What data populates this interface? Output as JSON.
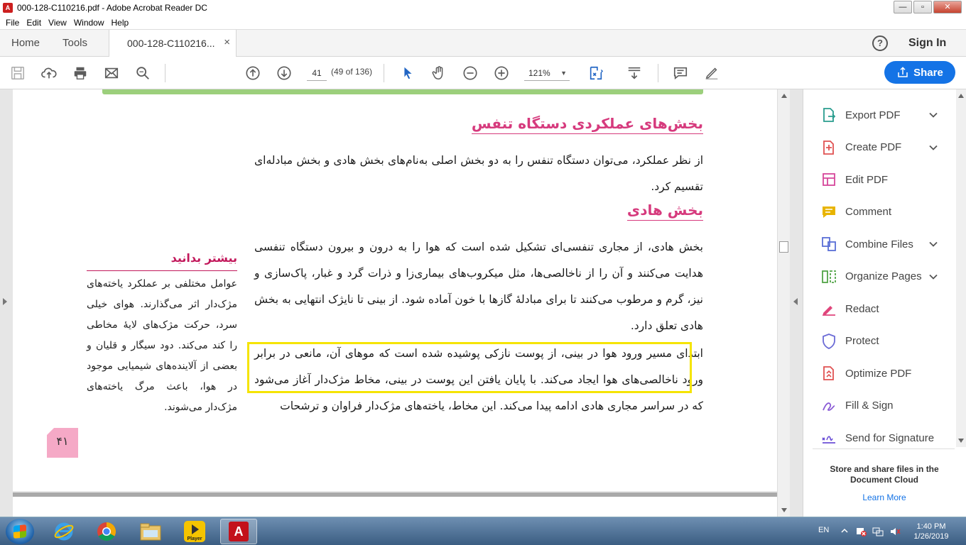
{
  "window": {
    "title": "000-128-C110216.pdf - Adobe Acrobat Reader DC",
    "buttons": {
      "minimize": "—",
      "maximize": "▫",
      "close": "✕"
    }
  },
  "menu": [
    "File",
    "Edit",
    "View",
    "Window",
    "Help"
  ],
  "tabs": {
    "home": "Home",
    "tools": "Tools",
    "document": "000-128-C110216...",
    "close": "×",
    "help": "?",
    "sign_in": "Sign In"
  },
  "toolbar": {
    "page_current": "41",
    "page_count": "(49 of 136)",
    "zoom": "121%",
    "zoom_dropdown": "▼",
    "share_label": "Share",
    "icons": [
      "save-icon",
      "upload-icon",
      "print-icon",
      "email-icon",
      "search-icon",
      "page-up-icon",
      "page-down-icon",
      "select-cursor-icon",
      "hand-icon",
      "zoom-out-icon",
      "zoom-in-icon",
      "fit-page-icon",
      "scroll-mode-icon",
      "comment-icon",
      "sign-pen-icon"
    ]
  },
  "document": {
    "heading_main": "بخش‌های عملکردی دستگاه تنفس",
    "para1": "از نظر عملکرد، می‌توان دستگاه تنفس را به دو بخش اصلی به‌نام‌های بخش هادی و بخش مبادله‌ای تقسیم کرد.",
    "heading_sub": "بخش هادی",
    "para2": "بخش هادی، از مجاری تنفسی‌ای تشکیل شده است که هوا را به درون و بیرون دستگاه تنفسی هدایت می‌کنند و آن را از ناخالصی‌ها، مثل میکروب‌های بیماری‌زا و ذرات گرد و غبار، پاک‌سازی و نیز، گرم و مرطوب می‌کنند تا برای مبادلهٔ گازها با خون آماده شود. از بینی تا نایژک انتهایی به بخش هادی تعلق دارد.",
    "para3": "ابتدای مسیر ورود هوا در بینی، از پوست نازکی پوشیده شده است که موهای آن، مانعی در برابر ورود ناخالصی‌های هوا ایجاد می‌کند. با پایان یافتن این پوست در بینی، مخاط مژک‌دار آغاز می‌شود که در سراسر مجاری هادی ادامه پیدا می‌کند. این مخاط، یاخته‌های مژک‌دار فراوان و ترشحات",
    "side_heading": "بیشتر بدانید",
    "side_text": "عوامل مختلفی بر عملکرد یاخته‌های مژک‌دار اثر می‌گذارند. هوای خیلی سرد، حرکت مژک‌های لایهٔ مخاطی را کند می‌کند. دود سیگار و قلیان و بعضی از آلاینده‌های شیمیایی موجود در هوا، باعث مرگ یاخته‌های مژک‌دار می‌شوند.",
    "page_number": "۴۱"
  },
  "right_panel": {
    "items": [
      {
        "label": "Export PDF",
        "icon": "export-pdf-icon",
        "chevron": true,
        "color": "#2a9d8f"
      },
      {
        "label": "Create PDF",
        "icon": "create-pdf-icon",
        "chevron": true,
        "color": "#e05252"
      },
      {
        "label": "Edit PDF",
        "icon": "edit-pdf-icon",
        "chevron": false,
        "color": "#d6479b"
      },
      {
        "label": "Comment",
        "icon": "comment-icon",
        "chevron": false,
        "color": "#e8b400"
      },
      {
        "label": "Combine Files",
        "icon": "combine-files-icon",
        "chevron": true,
        "color": "#5a6fd6"
      },
      {
        "label": "Organize Pages",
        "icon": "organize-pages-icon",
        "chevron": true,
        "color": "#52a447"
      },
      {
        "label": "Redact",
        "icon": "redact-icon",
        "chevron": false,
        "color": "#e0457b"
      },
      {
        "label": "Protect",
        "icon": "protect-icon",
        "chevron": false,
        "color": "#6b6bd6"
      },
      {
        "label": "Optimize PDF",
        "icon": "optimize-pdf-icon",
        "chevron": false,
        "color": "#e05252"
      },
      {
        "label": "Fill & Sign",
        "icon": "fill-sign-icon",
        "chevron": false,
        "color": "#8b5cd6"
      },
      {
        "label": "Send for Signature",
        "icon": "send-signature-icon",
        "chevron": false,
        "color": "#6b4fd6"
      }
    ],
    "store_text": "Store and share files in the Document Cloud",
    "learn_more": "Learn More"
  },
  "taskbar": {
    "lang": "EN",
    "time": "1:40 PM",
    "date": "1/26/2019",
    "player_label": "Player"
  }
}
